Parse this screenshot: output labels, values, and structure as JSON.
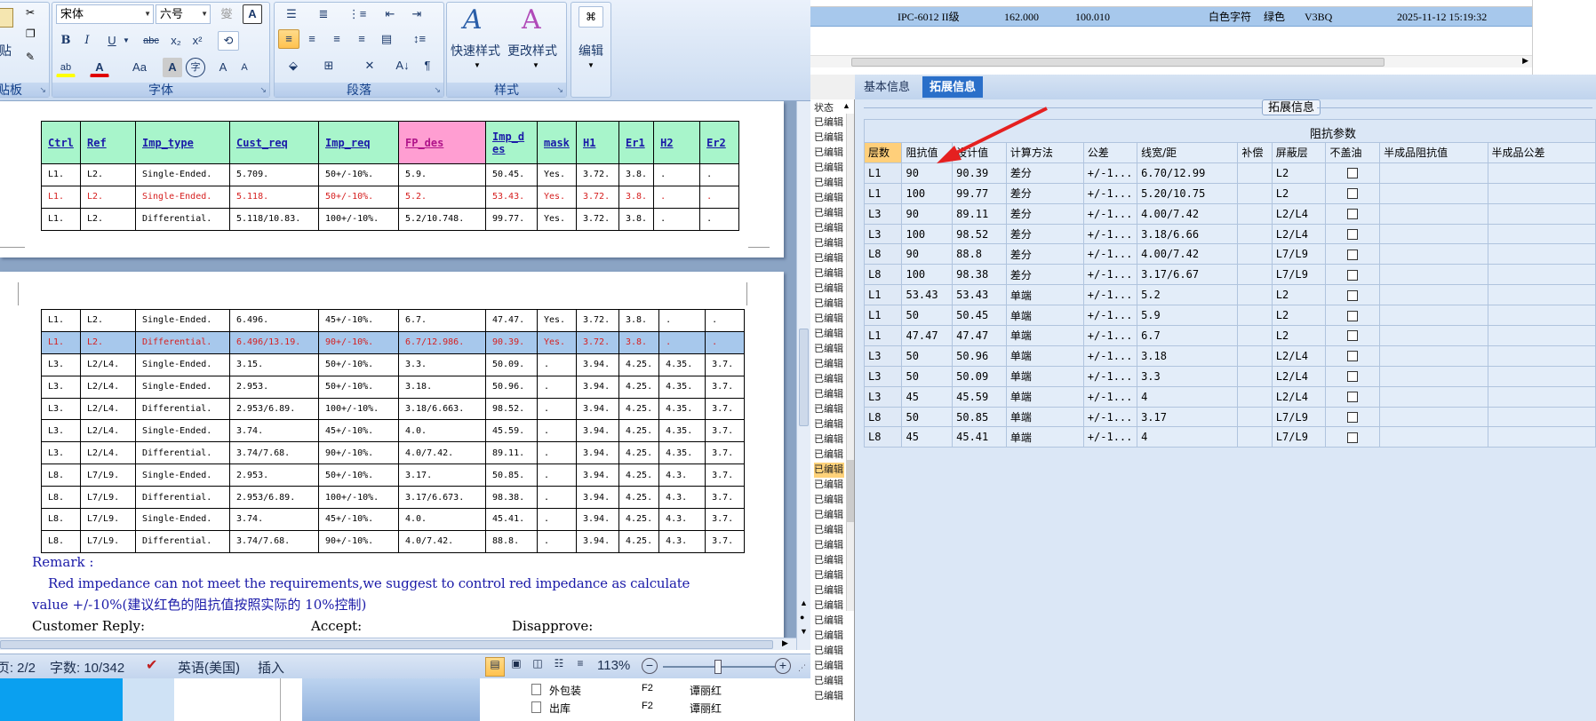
{
  "ribbon": {
    "clipboard_paste_label": "贴",
    "clipboard_group_label": "贴板",
    "font_name": "宋体",
    "font_size": "六号",
    "font_group_label": "字体",
    "para_group_label": "段落",
    "styles_group_label": "样式",
    "quick_styles_label": "快速样式",
    "change_styles_label": "更改样式",
    "edit_label": "编辑",
    "bold": "B",
    "italic": "I",
    "underline": "U",
    "strike": "abc",
    "sub": "x₂",
    "sup": "x²",
    "grow": "A",
    "shrink": "A",
    "case": "Aa",
    "charborder": "A",
    "phonetic": "文",
    "enclose": "字"
  },
  "top_record": {
    "name": "IPC-6012 II级",
    "v1": "162.000",
    "v2": "100.010",
    "col4": "白色字符",
    "col5": "绿色",
    "col6": "V3BQ",
    "time": "2025-11-12 15:19:32"
  },
  "doc": {
    "headers": [
      "Ctrl",
      "Ref",
      "Imp_type",
      "Cust_req",
      "Imp_req",
      "FP_des",
      "Imp_des",
      "mask",
      "H1",
      "Er1",
      "H2",
      "Er2"
    ],
    "page1_rows": [
      {
        "style": "normal",
        "cells": [
          "L1.",
          "L2.",
          "Single-Ended.",
          "5.709.",
          "50+/-10%.",
          "5.9.",
          "50.45.",
          "Yes.",
          "3.72.",
          "3.8.",
          ".",
          "."
        ]
      },
      {
        "style": "red",
        "cells": [
          "L1.",
          "L2.",
          "Single-Ended.",
          "5.118.",
          "50+/-10%.",
          "5.2.",
          "53.43.",
          "Yes.",
          "3.72.",
          "3.8.",
          ".",
          "."
        ]
      },
      {
        "style": "normal",
        "cells": [
          "L1.",
          "L2.",
          "Differential.",
          "5.118/10.83.",
          "100+/-10%.",
          "5.2/10.748.",
          "99.77.",
          "Yes.",
          "3.72.",
          "3.8.",
          ".",
          "."
        ]
      }
    ],
    "page2_rows": [
      {
        "style": "normal",
        "cells": [
          "L1.",
          "L2.",
          "Single-Ended.",
          "6.496.",
          "45+/-10%.",
          "6.7.",
          "47.47.",
          "Yes.",
          "3.72.",
          "3.8.",
          ".",
          "."
        ]
      },
      {
        "style": "sel",
        "cells": [
          "L1.",
          "L2.",
          "Differential.",
          "6.496/13.19.",
          "90+/-10%.",
          "6.7/12.986.",
          "90.39.",
          "Yes.",
          "3.72.",
          "3.8.",
          ".",
          "."
        ]
      },
      {
        "style": "normal",
        "cells": [
          "L3.",
          "L2/L4.",
          "Single-Ended.",
          "3.15.",
          "50+/-10%.",
          "3.3.",
          "50.09.",
          ".",
          "3.94.",
          "4.25.",
          "4.35.",
          "3.7."
        ]
      },
      {
        "style": "normal",
        "cells": [
          "L3.",
          "L2/L4.",
          "Single-Ended.",
          "2.953.",
          "50+/-10%.",
          "3.18.",
          "50.96.",
          ".",
          "3.94.",
          "4.25.",
          "4.35.",
          "3.7."
        ]
      },
      {
        "style": "normal",
        "cells": [
          "L3.",
          "L2/L4.",
          "Differential.",
          "2.953/6.89.",
          "100+/-10%.",
          "3.18/6.663.",
          "98.52.",
          ".",
          "3.94.",
          "4.25.",
          "4.35.",
          "3.7."
        ]
      },
      {
        "style": "normal",
        "cells": [
          "L3.",
          "L2/L4.",
          "Single-Ended.",
          "3.74.",
          "45+/-10%.",
          "4.0.",
          "45.59.",
          ".",
          "3.94.",
          "4.25.",
          "4.35.",
          "3.7."
        ]
      },
      {
        "style": "normal",
        "cells": [
          "L3.",
          "L2/L4.",
          "Differential.",
          "3.74/7.68.",
          "90+/-10%.",
          "4.0/7.42.",
          "89.11.",
          ".",
          "3.94.",
          "4.25.",
          "4.35.",
          "3.7."
        ]
      },
      {
        "style": "normal",
        "cells": [
          "L8.",
          "L7/L9.",
          "Single-Ended.",
          "2.953.",
          "50+/-10%.",
          "3.17.",
          "50.85.",
          ".",
          "3.94.",
          "4.25.",
          "4.3.",
          "3.7."
        ]
      },
      {
        "style": "normal",
        "cells": [
          "L8.",
          "L7/L9.",
          "Differential.",
          "2.953/6.89.",
          "100+/-10%.",
          "3.17/6.673.",
          "98.38.",
          ".",
          "3.94.",
          "4.25.",
          "4.3.",
          "3.7."
        ]
      },
      {
        "style": "normal",
        "cells": [
          "L8.",
          "L7/L9.",
          "Single-Ended.",
          "3.74.",
          "45+/-10%.",
          "4.0.",
          "45.41.",
          ".",
          "3.94.",
          "4.25.",
          "4.3.",
          "3.7."
        ]
      },
      {
        "style": "normal",
        "cells": [
          "L8.",
          "L7/L9.",
          "Differential.",
          "3.74/7.68.",
          "90+/-10%.",
          "4.0/7.42.",
          "88.8.",
          ".",
          "3.94.",
          "4.25.",
          "4.3.",
          "3.7."
        ]
      }
    ],
    "remark_label": "Remark :",
    "remark_line1": "Red impedance can not meet the requirements,we suggest to control red impedance as calculate",
    "remark_line2": "value +/-10%(建议红色的阻抗值按照实际的 10%控制)",
    "customer_reply": "Customer Reply:",
    "accept": "Accept:",
    "disapprove": "Disapprove:"
  },
  "statusbar": {
    "page": "页: 2/2",
    "words": "字数: 10/342",
    "lang": "英语(美国)",
    "mode": "插入",
    "zoom": "113%"
  },
  "bottom_list": [
    {
      "name": "外包装",
      "code": "F2",
      "person": "谭丽红"
    },
    {
      "name": "出库",
      "code": "F2",
      "person": "谭丽红"
    }
  ],
  "status_col": {
    "header": "状态",
    "items": [
      "已编辑",
      "已编辑",
      "已编辑",
      "已编辑",
      "已编辑",
      "已编辑",
      "已编辑",
      "已编辑",
      "已编辑",
      "已编辑",
      "已编辑",
      "已编辑",
      "已编辑",
      "已编辑",
      "已编辑",
      "已编辑",
      "已编辑",
      "已编辑",
      "已编辑",
      "已编辑",
      "已编辑",
      "已编辑",
      "已编辑",
      "已编辑",
      "已编辑",
      "已编辑",
      "已编辑",
      "已编辑",
      "已编辑",
      "已编辑",
      "已编辑",
      "已编辑",
      "已编辑",
      "已编辑",
      "已编辑",
      "已编辑",
      "已编辑",
      "已编辑",
      "已编辑"
    ]
  },
  "right_panel": {
    "tabs": [
      "基本信息",
      "拓展信息"
    ],
    "active_tab": "拓展信息",
    "section_title": "拓展信息",
    "group_title": "阻抗参数",
    "columns": [
      "层数",
      "阻抗值",
      "设计值",
      "计算方法",
      "公差",
      "线宽/距",
      "补偿",
      "屏蔽层",
      "不盖油",
      "半成品阻抗值",
      "半成品公差"
    ],
    "rows": [
      [
        "L1",
        "90",
        "90.39",
        "差分",
        "+/-1...",
        "6.70/12.99",
        "",
        "L2"
      ],
      [
        "L1",
        "100",
        "99.77",
        "差分",
        "+/-1...",
        "5.20/10.75",
        "",
        "L2"
      ],
      [
        "L3",
        "90",
        "89.11",
        "差分",
        "+/-1...",
        "4.00/7.42",
        "",
        "L2/L4"
      ],
      [
        "L3",
        "100",
        "98.52",
        "差分",
        "+/-1...",
        "3.18/6.66",
        "",
        "L2/L4"
      ],
      [
        "L8",
        "90",
        "88.8",
        "差分",
        "+/-1...",
        "4.00/7.42",
        "",
        "L7/L9"
      ],
      [
        "L8",
        "100",
        "98.38",
        "差分",
        "+/-1...",
        "3.17/6.67",
        "",
        "L7/L9"
      ],
      [
        "L1",
        "53.43",
        "53.43",
        "单端",
        "+/-1...",
        "5.2",
        "",
        "L2"
      ],
      [
        "L1",
        "50",
        "50.45",
        "单端",
        "+/-1...",
        "5.9",
        "",
        "L2"
      ],
      [
        "L1",
        "47.47",
        "47.47",
        "单端",
        "+/-1...",
        "6.7",
        "",
        "L2"
      ],
      [
        "L3",
        "50",
        "50.96",
        "单端",
        "+/-1...",
        "3.18",
        "",
        "L2/L4"
      ],
      [
        "L3",
        "50",
        "50.09",
        "单端",
        "+/-1...",
        "3.3",
        "",
        "L2/L4"
      ],
      [
        "L3",
        "45",
        "45.59",
        "单端",
        "+/-1...",
        "4",
        "",
        "L2/L4"
      ],
      [
        "L8",
        "50",
        "50.85",
        "单端",
        "+/-1...",
        "3.17",
        "",
        "L7/L9"
      ],
      [
        "L8",
        "45",
        "45.41",
        "单端",
        "+/-1...",
        "4",
        "",
        "L7/L9"
      ]
    ]
  },
  "colors": {
    "header_green": "#a8f5cb",
    "header_pink": "#ff9ed2",
    "header_imp": "#a8f5cb",
    "red_text": "#d62020",
    "sel_row": "#a7c8ec",
    "accent_tab": "#2a6fc9",
    "arrow": "#e52020"
  }
}
